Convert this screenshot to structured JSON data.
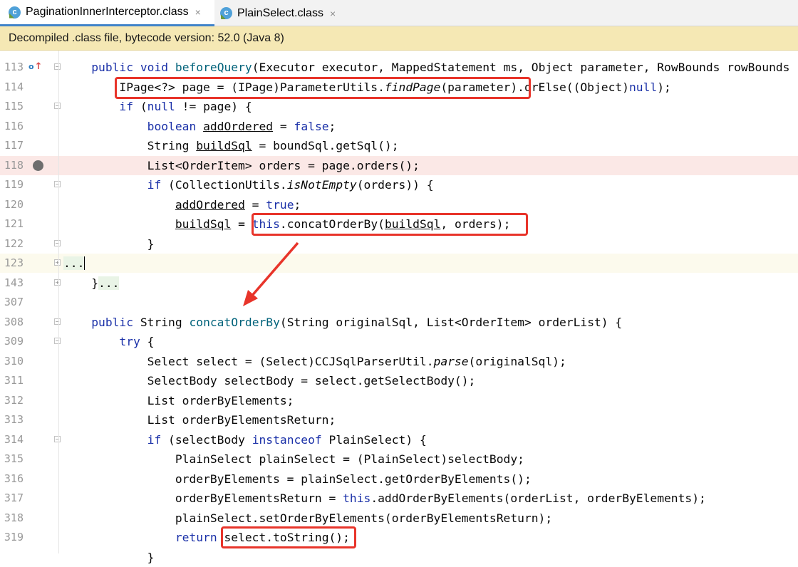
{
  "tabs": [
    {
      "label": "PaginationInnerInterceptor.class",
      "icon": "class-file-icon",
      "active": true
    },
    {
      "label": "PlainSelect.class",
      "icon": "class-file-icon",
      "active": false
    }
  ],
  "close_glyph": "×",
  "class_icon_glyph": "c",
  "info_bar": "Decompiled .class file, bytecode version: 52.0 (Java 8)",
  "colors": {
    "keyword": "#1a30a8",
    "method": "#00627a",
    "highlight_box": "#e8342a",
    "info_bar": "#f5e8b4",
    "active_tab": "#4083c9"
  },
  "gutter": {
    "override_glyph": "o",
    "override_arrow": "↑"
  },
  "lines": [
    {
      "num": "113",
      "segments": [
        {
          "t": "    "
        },
        {
          "t": "public",
          "k": "kw"
        },
        {
          "t": " "
        },
        {
          "t": "void",
          "k": "kw"
        },
        {
          "t": " "
        },
        {
          "t": "beforeQuery",
          "k": "fn"
        },
        {
          "t": "(Executor executor, MappedStatement ms, Object parameter, RowBounds rowBounds"
        }
      ]
    },
    {
      "num": "114",
      "segments": [
        {
          "t": "        IPage<?> page = (IPage)ParameterUtils."
        },
        {
          "t": "findPage",
          "k": "it"
        },
        {
          "t": "(parameter).orElse((Object)"
        },
        {
          "t": "null",
          "k": "kw"
        },
        {
          "t": ");"
        }
      ]
    },
    {
      "num": "115",
      "segments": [
        {
          "t": "        "
        },
        {
          "t": "if",
          "k": "kw"
        },
        {
          "t": " ("
        },
        {
          "t": "null",
          "k": "kw"
        },
        {
          "t": " != page) {"
        }
      ]
    },
    {
      "num": "116",
      "segments": [
        {
          "t": "            "
        },
        {
          "t": "boolean",
          "k": "kw"
        },
        {
          "t": " "
        },
        {
          "t": "addOrdered",
          "k": "ul"
        },
        {
          "t": " = "
        },
        {
          "t": "false",
          "k": "kw"
        },
        {
          "t": ";"
        }
      ]
    },
    {
      "num": "117",
      "segments": [
        {
          "t": "            String "
        },
        {
          "t": "buildSql",
          "k": "ul"
        },
        {
          "t": " = boundSql.getSql();"
        }
      ]
    },
    {
      "num": "118",
      "segments": [
        {
          "t": "            List<OrderItem> orders = page.orders();"
        }
      ]
    },
    {
      "num": "119",
      "segments": [
        {
          "t": "            "
        },
        {
          "t": "if",
          "k": "kw"
        },
        {
          "t": " (CollectionUtils."
        },
        {
          "t": "isNotEmpty",
          "k": "it"
        },
        {
          "t": "(orders)) {"
        }
      ]
    },
    {
      "num": "120",
      "segments": [
        {
          "t": "                "
        },
        {
          "t": "addOrdered",
          "k": "ul"
        },
        {
          "t": " = "
        },
        {
          "t": "true",
          "k": "kw"
        },
        {
          "t": ";"
        }
      ]
    },
    {
      "num": "121",
      "segments": [
        {
          "t": "                "
        },
        {
          "t": "buildSql",
          "k": "ul"
        },
        {
          "t": " = "
        },
        {
          "t": "this",
          "k": "kw"
        },
        {
          "t": ".concatOrderBy("
        },
        {
          "t": "buildSql",
          "k": "ul"
        },
        {
          "t": ", orders);"
        }
      ]
    },
    {
      "num": "122",
      "segments": [
        {
          "t": "            }"
        }
      ]
    },
    {
      "num": "123",
      "segments": [
        {
          "t": "...",
          "k": "fb"
        }
      ]
    },
    {
      "num": "143",
      "segments": [
        {
          "t": "    }"
        },
        {
          "t": "...",
          "k": "fb"
        }
      ]
    },
    {
      "num": "307",
      "segments": []
    },
    {
      "num": "308",
      "segments": [
        {
          "t": "    "
        },
        {
          "t": "public",
          "k": "kw"
        },
        {
          "t": " String "
        },
        {
          "t": "concatOrderBy",
          "k": "fn"
        },
        {
          "t": "(String originalSql, List<OrderItem> orderList) {"
        }
      ]
    },
    {
      "num": "309",
      "segments": [
        {
          "t": "        "
        },
        {
          "t": "try",
          "k": "kw"
        },
        {
          "t": " {"
        }
      ]
    },
    {
      "num": "310",
      "segments": [
        {
          "t": "            Select select = (Select)CCJSqlParserUtil."
        },
        {
          "t": "parse",
          "k": "it"
        },
        {
          "t": "(originalSql);"
        }
      ]
    },
    {
      "num": "311",
      "segments": [
        {
          "t": "            SelectBody selectBody = select.getSelectBody();"
        }
      ]
    },
    {
      "num": "312",
      "segments": [
        {
          "t": "            List orderByElements;"
        }
      ]
    },
    {
      "num": "313",
      "segments": [
        {
          "t": "            List orderByElementsReturn;"
        }
      ]
    },
    {
      "num": "314",
      "segments": [
        {
          "t": "            "
        },
        {
          "t": "if",
          "k": "kw"
        },
        {
          "t": " (selectBody "
        },
        {
          "t": "instanceof",
          "k": "kw"
        },
        {
          "t": " PlainSelect) {"
        }
      ]
    },
    {
      "num": "315",
      "segments": [
        {
          "t": "                PlainSelect plainSelect = (PlainSelect)selectBody;"
        }
      ]
    },
    {
      "num": "316",
      "segments": [
        {
          "t": "                orderByElements = plainSelect.getOrderByElements();"
        }
      ]
    },
    {
      "num": "317",
      "segments": [
        {
          "t": "                orderByElementsReturn = "
        },
        {
          "t": "this",
          "k": "kw"
        },
        {
          "t": ".addOrderByElements(orderList, orderByElements);"
        }
      ]
    },
    {
      "num": "318",
      "segments": [
        {
          "t": "                plainSelect.setOrderByElements(orderByElementsReturn);"
        }
      ]
    },
    {
      "num": "319",
      "segments": [
        {
          "t": "                "
        },
        {
          "t": "return",
          "k": "kw"
        },
        {
          "t": " select.toString();"
        }
      ]
    },
    {
      "num": "",
      "segments": [
        {
          "t": "            }"
        }
      ]
    }
  ]
}
